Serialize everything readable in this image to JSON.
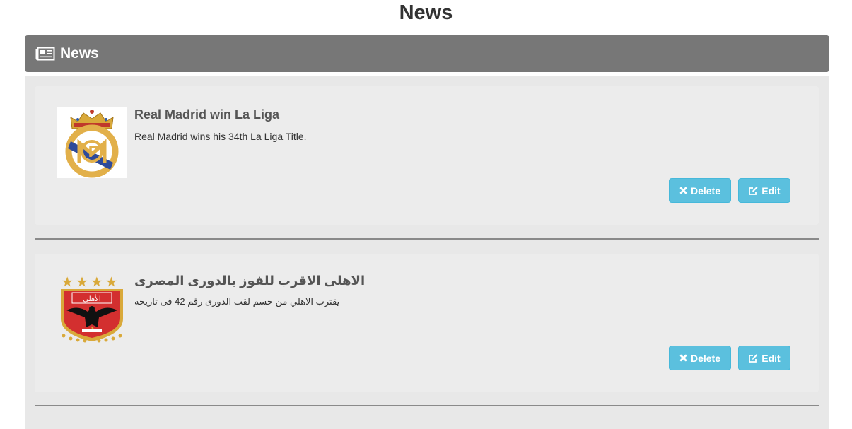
{
  "page": {
    "title": "News"
  },
  "panel": {
    "heading": "News",
    "heading_icon": "newspaper-icon"
  },
  "news": [
    {
      "title": "Real Madrid win La Liga",
      "text": "Real Madrid wins his 34th La Liga Title.",
      "image": "real-madrid-crest",
      "delete_label": "Delete",
      "edit_label": "Edit"
    },
    {
      "title": "الاهلى الاقرب للفوز بالدورى المصرى",
      "text": "يقترب الاهلي من حسم لقب الدورى رقم 42 فى تاريخه",
      "image": "al-ahly-crest",
      "delete_label": "Delete",
      "edit_label": "Edit"
    }
  ],
  "colors": {
    "heading_bg": "#777777",
    "button_bg": "#5bc0de",
    "panel_bg": "#e8e8e8"
  }
}
